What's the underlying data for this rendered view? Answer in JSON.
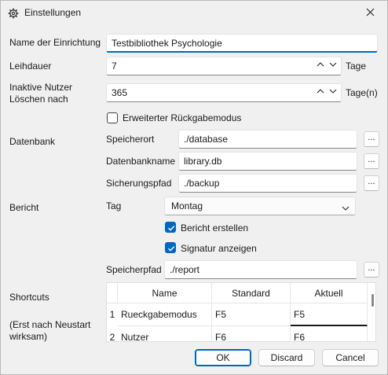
{
  "window": {
    "title": "Einstellungen",
    "title_icon": "gear-icon",
    "close_icon": "close-icon"
  },
  "general": {
    "name_label": "Name der Einrichtung",
    "name_value": "Testbibliothek Psychologie",
    "loan_label": "Leihdauer",
    "loan_value": "7",
    "loan_unit": "Tage",
    "inactive_label_line1": "Inaktive Nutzer",
    "inactive_label_line2": "Löschen nach",
    "inactive_value": "365",
    "inactive_unit": "Tage(n)",
    "extended_return_label": "Erweiterter Rückgabemodus",
    "extended_return_checked": false
  },
  "database": {
    "section_label": "Datenbank",
    "location_label": "Speicherort",
    "location_value": "./database",
    "name_label": "Datenbankname",
    "name_value": "library.db",
    "backup_label": "Sicherungspfad",
    "backup_value": "./backup",
    "browse_label": "..."
  },
  "report": {
    "section_label": "Bericht",
    "day_label": "Tag",
    "day_value": "Montag",
    "create_label": "Bericht erstellen",
    "create_checked": true,
    "signature_label": "Signatur anzeigen",
    "signature_checked": true,
    "path_label": "Speicherpfad",
    "path_value": "./report",
    "browse_label": "..."
  },
  "shortcuts": {
    "section_label": "Shortcuts",
    "note_line1": "(Erst nach Neustart",
    "note_line2": "wirksam)",
    "columns": [
      "Name",
      "Standard",
      "Aktuell"
    ],
    "rows": [
      {
        "index": "1",
        "name": "Rueckgabemodus",
        "standard": "F5",
        "current": "F5"
      },
      {
        "index": "2",
        "name": "Nutzer",
        "standard": "F6",
        "current": "F6"
      }
    ]
  },
  "buttons": {
    "ok": "OK",
    "discard": "Discard",
    "cancel": "Cancel"
  },
  "colors": {
    "accent": "#0067c0",
    "background": "#f0f0f0"
  }
}
